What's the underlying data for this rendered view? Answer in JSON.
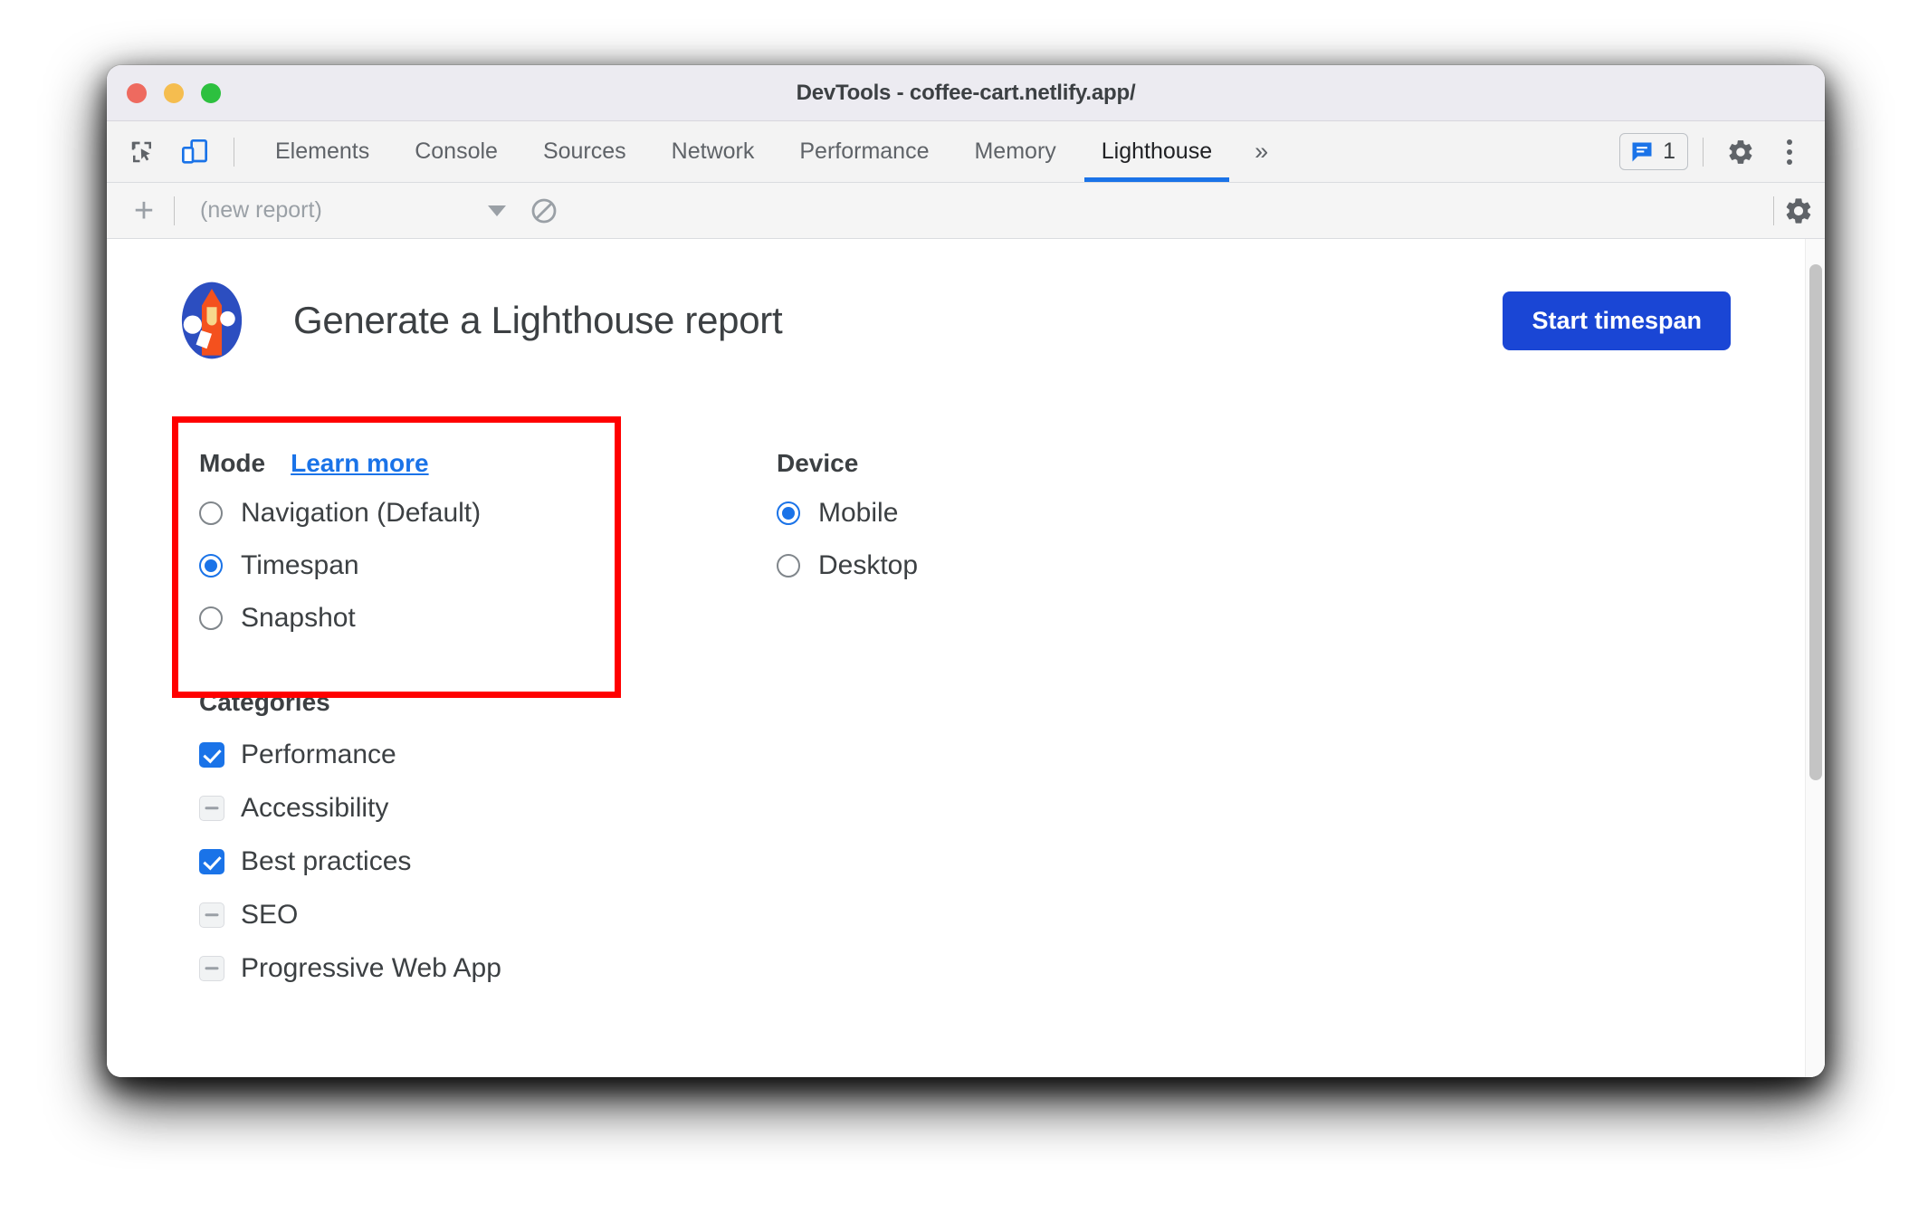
{
  "window": {
    "title": "DevTools - coffee-cart.netlify.app/",
    "traffic_lights": [
      "close",
      "minimize",
      "zoom"
    ]
  },
  "devtools_tabbar": {
    "inspect_icon": "inspect-element-icon",
    "device_toolbar_icon": "device-toolbar-icon",
    "tabs": [
      {
        "label": "Elements",
        "active": false
      },
      {
        "label": "Console",
        "active": false
      },
      {
        "label": "Sources",
        "active": false
      },
      {
        "label": "Network",
        "active": false
      },
      {
        "label": "Performance",
        "active": false
      },
      {
        "label": "Memory",
        "active": false
      },
      {
        "label": "Lighthouse",
        "active": true
      }
    ],
    "more_tabs_label": "»",
    "issues": {
      "icon": "issues-message-icon",
      "count": "1"
    },
    "settings_icon": "gear-icon",
    "more_options_icon": "kebab-menu-icon"
  },
  "lighthouse_toolbar": {
    "add_label": "+",
    "report_select_value": "(new report)",
    "clear_icon": "clear-all-icon",
    "settings_icon": "gear-icon"
  },
  "main": {
    "logo": "lighthouse-logo",
    "title": "Generate a Lighthouse report",
    "start_button": "Start timespan",
    "mode": {
      "title": "Mode",
      "learn_more": "Learn more",
      "options": [
        {
          "label": "Navigation (Default)",
          "selected": false
        },
        {
          "label": "Timespan",
          "selected": true
        },
        {
          "label": "Snapshot",
          "selected": false
        }
      ]
    },
    "device": {
      "title": "Device",
      "options": [
        {
          "label": "Mobile",
          "selected": true
        },
        {
          "label": "Desktop",
          "selected": false
        }
      ]
    },
    "categories": {
      "title": "Categories",
      "items": [
        {
          "label": "Performance",
          "state": "checked"
        },
        {
          "label": "Accessibility",
          "state": "indeterminate"
        },
        {
          "label": "Best practices",
          "state": "checked"
        },
        {
          "label": "SEO",
          "state": "indeterminate"
        },
        {
          "label": "Progressive Web App",
          "state": "indeterminate"
        }
      ]
    }
  },
  "annotation": {
    "shape": "rectangle",
    "color": "#ff0000",
    "targets": "mode-section"
  },
  "colors": {
    "accent_blue": "#1a73e8",
    "button_blue": "#1a46d5",
    "annotation_red": "#ff0000",
    "text_primary": "#3c4043",
    "text_muted": "#9aa0a6"
  },
  "scrollbar": {
    "orientation": "vertical"
  }
}
